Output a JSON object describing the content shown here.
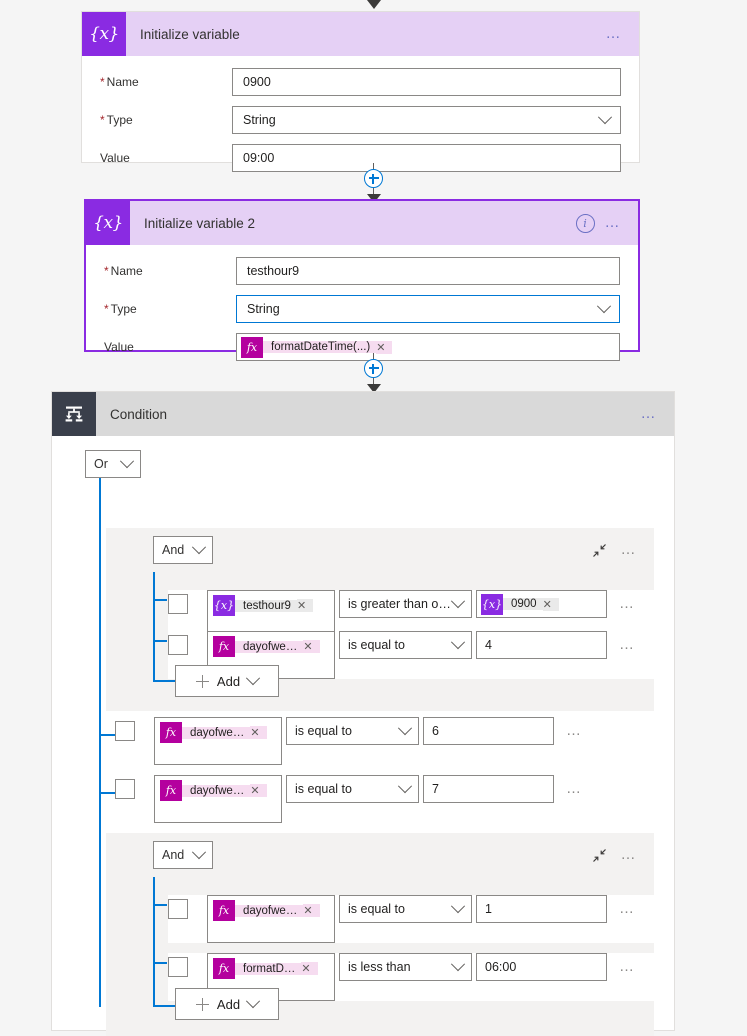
{
  "cards": {
    "init_variable_1": {
      "title": "Initialize variable",
      "icon": "variable-braces-icon",
      "menu": "…",
      "fields": [
        {
          "label": "Name",
          "required": true,
          "value": "0900",
          "control": "text"
        },
        {
          "label": "Type",
          "required": true,
          "value": "String",
          "control": "dropdown"
        },
        {
          "label": "Value",
          "required": false,
          "value": "09:00",
          "control": "text"
        }
      ]
    },
    "init_variable_2": {
      "title": "Initialize variable 2",
      "icon": "variable-braces-icon",
      "menu": "…",
      "info_icon": "i",
      "selected": true,
      "fields": [
        {
          "label": "Name",
          "required": true,
          "value": "testhour9",
          "control": "text"
        },
        {
          "label": "Type",
          "required": true,
          "value": "String",
          "control": "dropdown"
        },
        {
          "label": "Value",
          "required": false,
          "control": "token",
          "token": {
            "kind": "fx",
            "badge": "fx",
            "label": "formatDateTime(...)",
            "remove": "✕"
          }
        }
      ]
    },
    "condition": {
      "title": "Condition",
      "icon": "condition-branch-icon",
      "menu": "…",
      "root_operator": "Or",
      "groups": [
        {
          "type": "group",
          "operator": "And",
          "collapse_label": "collapse",
          "menu": "…",
          "rows": [
            {
              "left_token": {
                "kind": "var",
                "badge": "{x}",
                "label": "testhour9",
                "remove": "✕"
              },
              "operator": "is greater than o…",
              "value_token": {
                "kind": "var",
                "badge": "{x}",
                "label": "0900",
                "remove": "✕"
              },
              "menu": "…"
            },
            {
              "left_token": {
                "kind": "fx",
                "badge": "fx",
                "label": "dayofwe…",
                "remove": "✕"
              },
              "operator": "is equal to",
              "value": "4",
              "menu": "…"
            }
          ],
          "add_label": "Add"
        },
        {
          "type": "row",
          "left_token": {
            "kind": "fx",
            "badge": "fx",
            "label": "dayofwe…",
            "remove": "✕"
          },
          "operator": "is equal to",
          "value": "6",
          "menu": "…"
        },
        {
          "type": "row",
          "left_token": {
            "kind": "fx",
            "badge": "fx",
            "label": "dayofwe…",
            "remove": "✕"
          },
          "operator": "is equal to",
          "value": "7",
          "menu": "…"
        },
        {
          "type": "group",
          "operator": "And",
          "collapse_label": "collapse",
          "menu": "…",
          "rows": [
            {
              "left_token": {
                "kind": "fx",
                "badge": "fx",
                "label": "dayofwe…",
                "remove": "✕"
              },
              "operator": "is equal to",
              "value": "1",
              "menu": "…"
            },
            {
              "left_token": {
                "kind": "fx",
                "badge": "fx",
                "label": "formatD…",
                "remove": "✕"
              },
              "operator": "is less than",
              "value": "06:00",
              "menu": "…"
            }
          ],
          "add_label": "Add"
        }
      ]
    }
  },
  "connectors": {
    "insert_label": "+"
  },
  "colors": {
    "variable_accent": "#8a2be2",
    "variable_header": "#e5d0f5",
    "condition_icon": "#3a3f4b",
    "condition_header": "#d9d9d9",
    "function_token": "#b4009e",
    "rail_blue": "#0078d4",
    "page_background": "#f5f5f5"
  }
}
